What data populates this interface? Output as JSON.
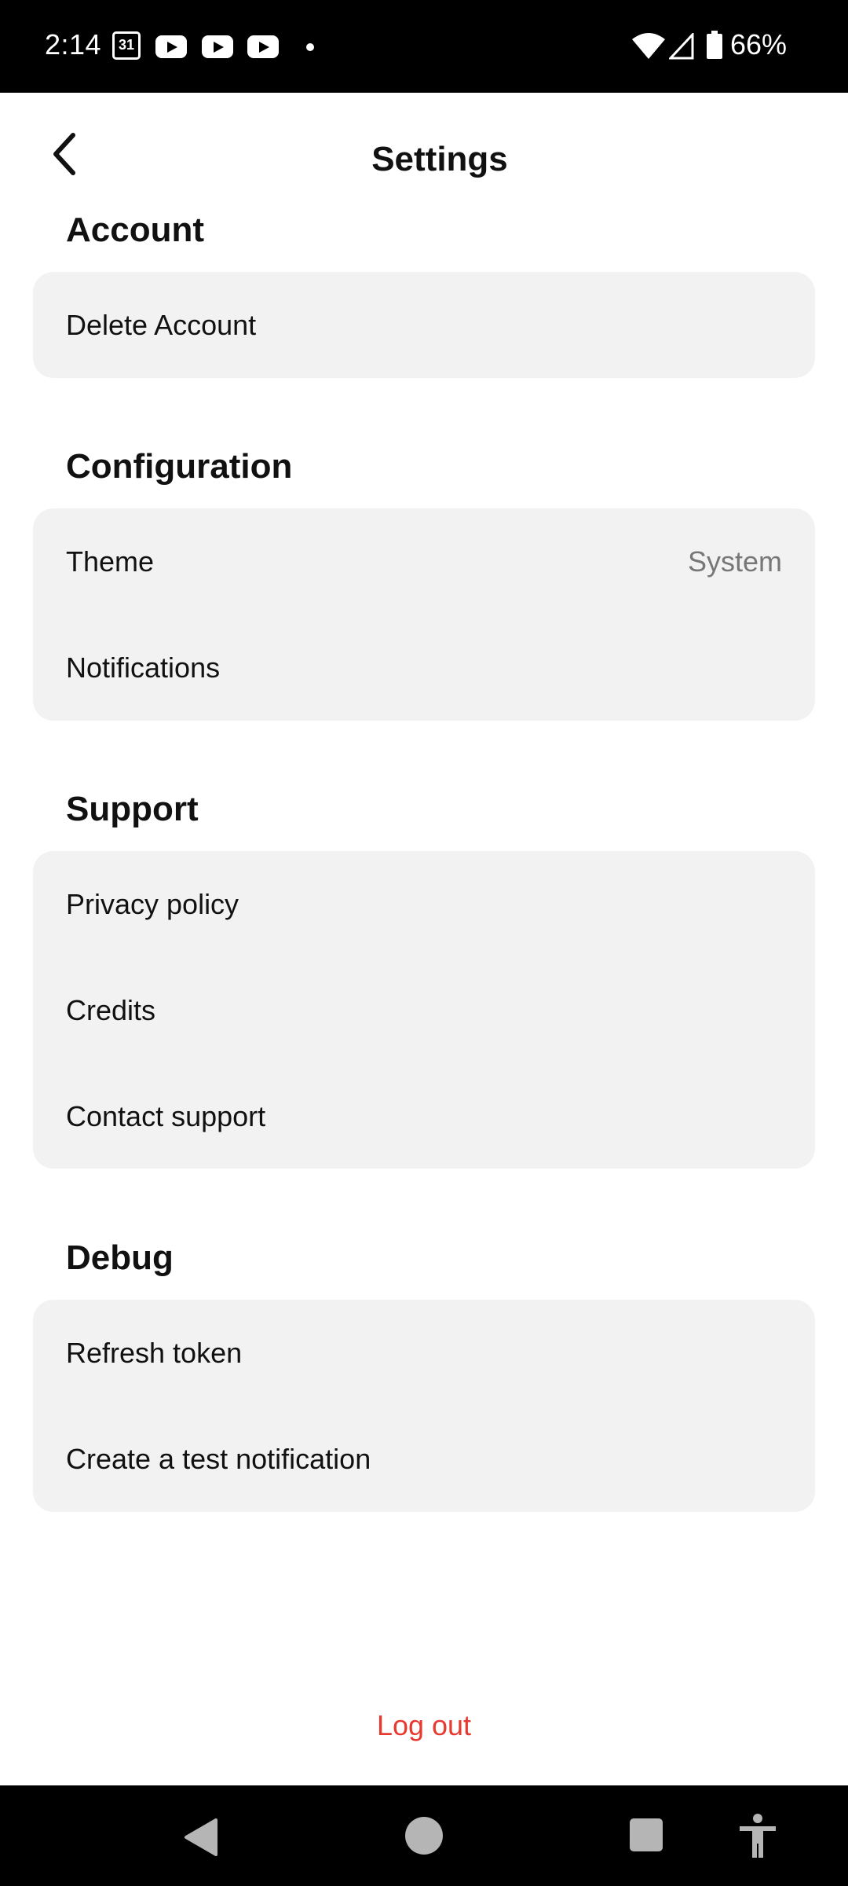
{
  "status_bar": {
    "time": "2:14",
    "calendar_day": "31",
    "battery": "66%"
  },
  "header": {
    "title": "Settings",
    "back_icon": "chevron-left-icon"
  },
  "sections": {
    "account": {
      "title": "Account",
      "items": [
        {
          "label": "Delete Account"
        }
      ]
    },
    "configuration": {
      "title": "Configuration",
      "items": [
        {
          "label": "Theme",
          "value": "System"
        },
        {
          "label": "Notifications"
        }
      ]
    },
    "support": {
      "title": "Support",
      "items": [
        {
          "label": "Privacy policy"
        },
        {
          "label": "Credits"
        },
        {
          "label": "Contact support"
        }
      ]
    },
    "debug": {
      "title": "Debug",
      "items": [
        {
          "label": "Refresh token"
        },
        {
          "label": "Create a test notification"
        }
      ]
    }
  },
  "logout_label": "Log out",
  "colors": {
    "card_bg": "#f2f2f2",
    "logout": "#e8392f",
    "secondary_text": "#777777"
  }
}
